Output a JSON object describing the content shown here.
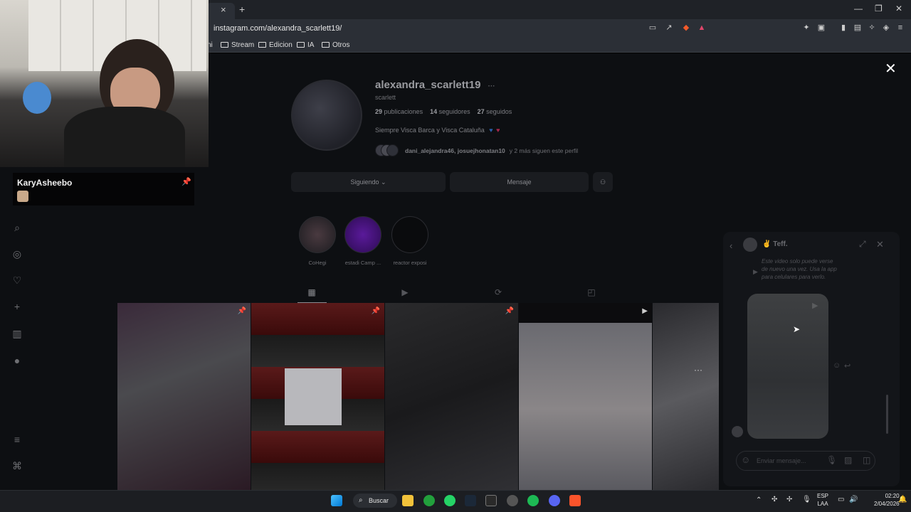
{
  "browser": {
    "tab_close": "×",
    "new_tab": "+",
    "url": "instagram.com/alexandra_scarlett19/",
    "bookmarks": [
      "ni",
      "Stream",
      "Edicion",
      "IA",
      "Otros"
    ],
    "window_controls": [
      "—",
      "❐",
      "✕"
    ]
  },
  "instagram": {
    "overlay_close": "✕",
    "username": "alexandra_scarlett19",
    "more": "···",
    "full_name": "scarlett",
    "stats": {
      "posts_count": "29",
      "posts_label": "publicaciones",
      "followers_count": "14",
      "followers_label": "seguidores",
      "following_count": "27",
      "following_label": "seguidos"
    },
    "bio": "Siempre Visca Barca y Visca Cataluña",
    "bio_emojis": [
      "blue-heart",
      "pink-heart"
    ],
    "followed_by_names": "dani_alejandra46, josuejhonatan10",
    "followed_by_suffix": "y 2 más siguen este perfil",
    "buttons": {
      "following": "Siguiendo",
      "message": "Mensaje"
    },
    "highlights": [
      {
        "label": "CoHegi"
      },
      {
        "label": "estadi Camp ..."
      },
      {
        "label": "reactor exposi"
      }
    ],
    "profile_tabs": [
      "grid-icon",
      "reels-icon",
      "reposts-icon",
      "tagged-icon"
    ]
  },
  "dm_chat": {
    "name": "✌️ Teff.",
    "message": "Este video solo puede verse de nuevo una vez. Usa la app para celulares para verlo.",
    "input_placeholder": "Enviar mensaje..."
  },
  "stream_overlay": {
    "chat_user": "KaryAsheebo"
  },
  "taskbar": {
    "search_label": "Buscar",
    "lang_primary": "ESP",
    "lang_secondary": "LAA",
    "time": "02:20",
    "date": "2/04/2026"
  }
}
